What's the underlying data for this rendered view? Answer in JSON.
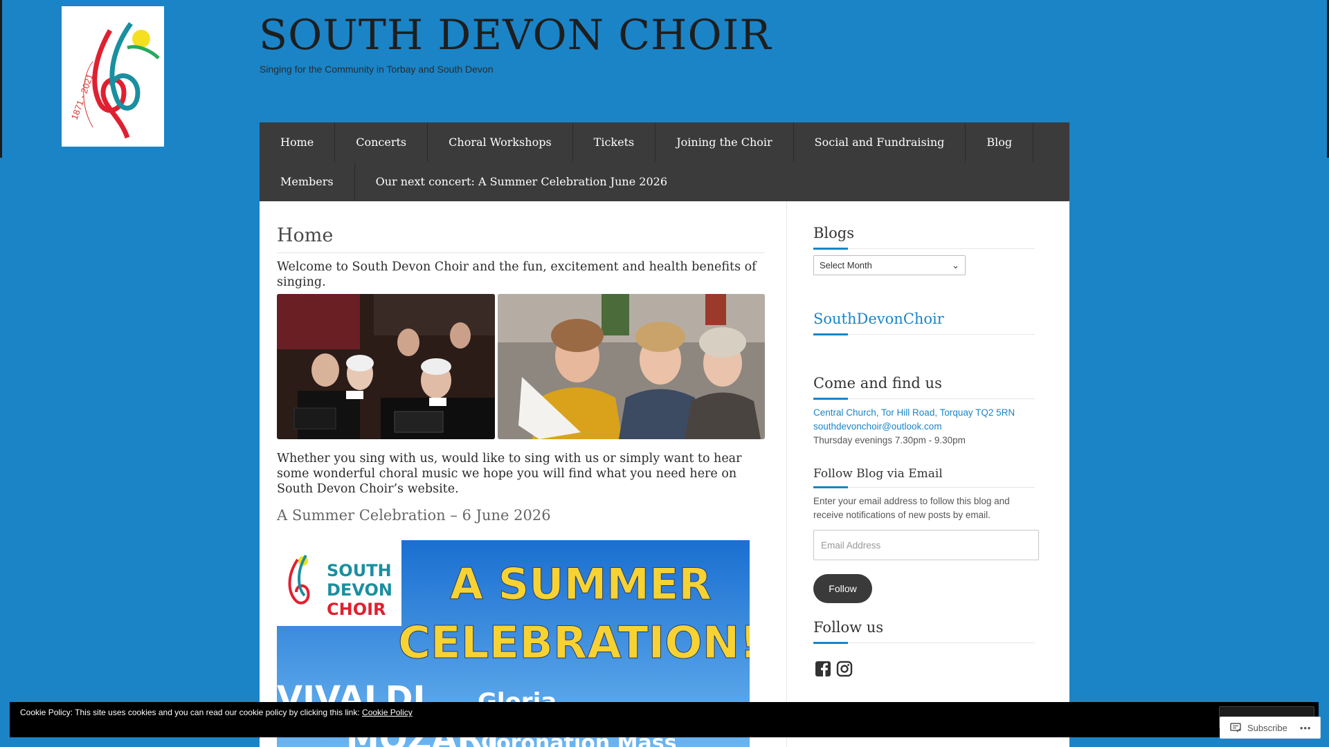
{
  "site": {
    "title": "SOUTH DEVON CHOIR",
    "tagline": "Singing for the Community in Torbay and South Devon",
    "logo_text": "1871 - 2021"
  },
  "nav": {
    "row1": [
      "Home",
      "Concerts",
      "Choral Workshops",
      "Tickets",
      "Joining the Choir",
      "Social and Fundraising",
      "Blog"
    ],
    "row2": [
      "Members",
      "Our next concert: A Summer Celebration June 2026"
    ]
  },
  "main": {
    "page_title": "Home",
    "intro": "Welcome to South Devon Choir and the fun, excitement and health benefits of singing.",
    "paragraph": "Whether you sing with us, would like to sing with us or simply want to hear some wonderful choral music we hope you will find what you need here on South Devon Choir’s website.",
    "concert_heading": "A Summer Celebration – 6 June 2026",
    "poster": {
      "logo_line1": "SOUTH",
      "logo_line2": "DEVON",
      "logo_line3": "CHOIR",
      "headline1": "A SUMMER",
      "headline2": "CELEBRATION!",
      "composer1": "VIVALDI",
      "work1": "Gloria",
      "composer2": "MOZART",
      "work2": "Coronation Mass"
    }
  },
  "sidebar": {
    "blogs_title": "Blogs",
    "select_month": "Select Month",
    "sdc_title": "SouthDevonChoir",
    "find_title": "Come and find us",
    "address": "Central Church, Tor Hill Road, Torquay TQ2 5RN",
    "email": "southdevonchoir@outlook.com",
    "hours": "Thursday evenings 7.30pm - 9.30pm",
    "follow_email_title": "Follow Blog via Email",
    "follow_email_desc": "Enter your email address to follow this blog and receive notifications of new posts by email.",
    "email_placeholder": "Email Address",
    "follow_button": "Follow",
    "follow_us_title": "Follow us"
  },
  "cookie": {
    "text": "Cookie Policy: This site uses cookies and you can read our cookie policy by clicking this link:",
    "link": "Cookie Policy"
  },
  "subscribe": {
    "label": "Subscribe",
    "more": "•••"
  },
  "colors": {
    "background": "#1a84c7",
    "nav": "#3b3b3b",
    "accent": "#1a84c7"
  },
  "icons": [
    "facebook-icon",
    "instagram-icon",
    "subscribe-icon"
  ]
}
